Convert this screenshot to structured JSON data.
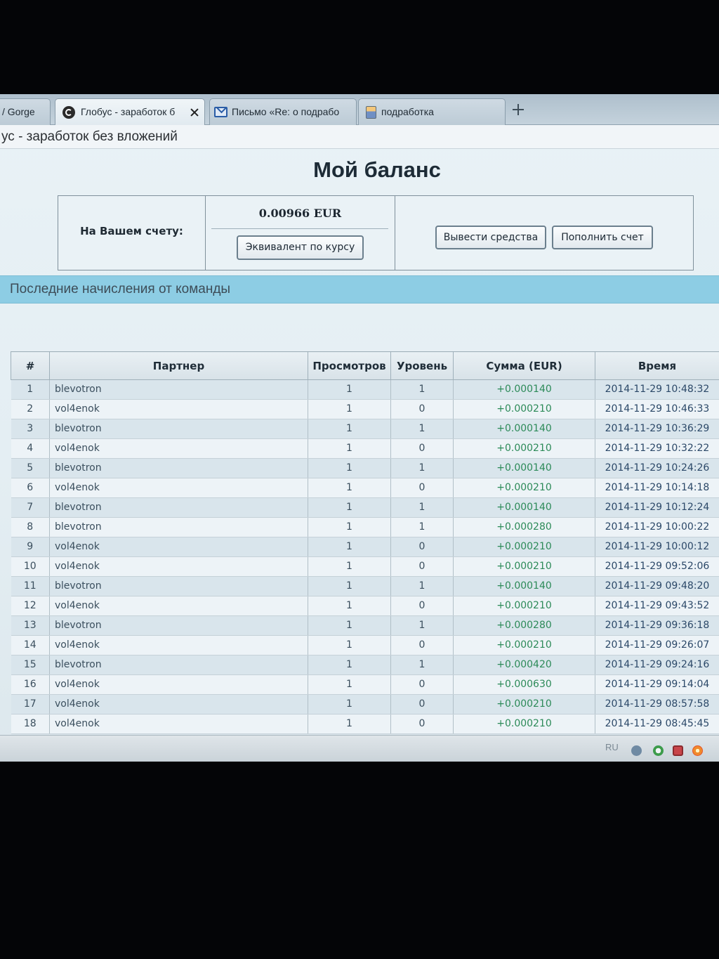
{
  "browser": {
    "tabs": [
      {
        "label": "/ Gorge"
      },
      {
        "label": "Глобус - заработок б",
        "icon": "site-favicon-icon",
        "active": true
      },
      {
        "label": "Письмо «Re: о подрабо",
        "icon": "mail-icon"
      },
      {
        "label": "подработка",
        "icon": "document-icon"
      }
    ],
    "page_title": "ус - заработок без вложений"
  },
  "balance": {
    "heading": "Мой баланс",
    "label": "На Вашем счету:",
    "amount": "0.00966 EUR",
    "equivalent_button": "Эквивалент по курсу",
    "withdraw_button": "Вывести средства",
    "deposit_button": "Пополнить счет"
  },
  "team": {
    "section_title": "Последние начисления от команды",
    "columns": [
      "#",
      "Партнер",
      "Просмотров",
      "Уровень",
      "Сумма (EUR)",
      "Время"
    ],
    "rows": [
      {
        "n": "1",
        "partner": "blevotron",
        "views": "1",
        "level": "1",
        "sum": "+0.000140",
        "time": "2014-11-29 10:48:32"
      },
      {
        "n": "2",
        "partner": "vol4enok",
        "views": "1",
        "level": "0",
        "sum": "+0.000210",
        "time": "2014-11-29 10:46:33"
      },
      {
        "n": "3",
        "partner": "blevotron",
        "views": "1",
        "level": "1",
        "sum": "+0.000140",
        "time": "2014-11-29 10:36:29"
      },
      {
        "n": "4",
        "partner": "vol4enok",
        "views": "1",
        "level": "0",
        "sum": "+0.000210",
        "time": "2014-11-29 10:32:22"
      },
      {
        "n": "5",
        "partner": "blevotron",
        "views": "1",
        "level": "1",
        "sum": "+0.000140",
        "time": "2014-11-29 10:24:26"
      },
      {
        "n": "6",
        "partner": "vol4enok",
        "views": "1",
        "level": "0",
        "sum": "+0.000210",
        "time": "2014-11-29 10:14:18"
      },
      {
        "n": "7",
        "partner": "blevotron",
        "views": "1",
        "level": "1",
        "sum": "+0.000140",
        "time": "2014-11-29 10:12:24"
      },
      {
        "n": "8",
        "partner": "blevotron",
        "views": "1",
        "level": "1",
        "sum": "+0.000280",
        "time": "2014-11-29 10:00:22"
      },
      {
        "n": "9",
        "partner": "vol4enok",
        "views": "1",
        "level": "0",
        "sum": "+0.000210",
        "time": "2014-11-29 10:00:12"
      },
      {
        "n": "10",
        "partner": "vol4enok",
        "views": "1",
        "level": "0",
        "sum": "+0.000210",
        "time": "2014-11-29 09:52:06"
      },
      {
        "n": "11",
        "partner": "blevotron",
        "views": "1",
        "level": "1",
        "sum": "+0.000140",
        "time": "2014-11-29 09:48:20"
      },
      {
        "n": "12",
        "partner": "vol4enok",
        "views": "1",
        "level": "0",
        "sum": "+0.000210",
        "time": "2014-11-29 09:43:52"
      },
      {
        "n": "13",
        "partner": "blevotron",
        "views": "1",
        "level": "1",
        "sum": "+0.000280",
        "time": "2014-11-29 09:36:18"
      },
      {
        "n": "14",
        "partner": "vol4enok",
        "views": "1",
        "level": "0",
        "sum": "+0.000210",
        "time": "2014-11-29 09:26:07"
      },
      {
        "n": "15",
        "partner": "blevotron",
        "views": "1",
        "level": "1",
        "sum": "+0.000420",
        "time": "2014-11-29 09:24:16"
      },
      {
        "n": "16",
        "partner": "vol4enok",
        "views": "1",
        "level": "0",
        "sum": "+0.000630",
        "time": "2014-11-29 09:14:04"
      },
      {
        "n": "17",
        "partner": "vol4enok",
        "views": "1",
        "level": "0",
        "sum": "+0.000210",
        "time": "2014-11-29 08:57:58"
      },
      {
        "n": "18",
        "partner": "vol4enok",
        "views": "1",
        "level": "0",
        "sum": "+0.000210",
        "time": "2014-11-29 08:45:45"
      }
    ]
  },
  "taskbar": {
    "language": "RU",
    "tray_icons": [
      "tray-expand-icon",
      "tray-network-icon",
      "tray-shield-icon",
      "tray-flower-icon"
    ]
  },
  "colors": {
    "section_band": "#8dcde4",
    "sum_text": "#2c8a58",
    "time_text": "#2b4868",
    "heading_text": "#1d2b36"
  }
}
